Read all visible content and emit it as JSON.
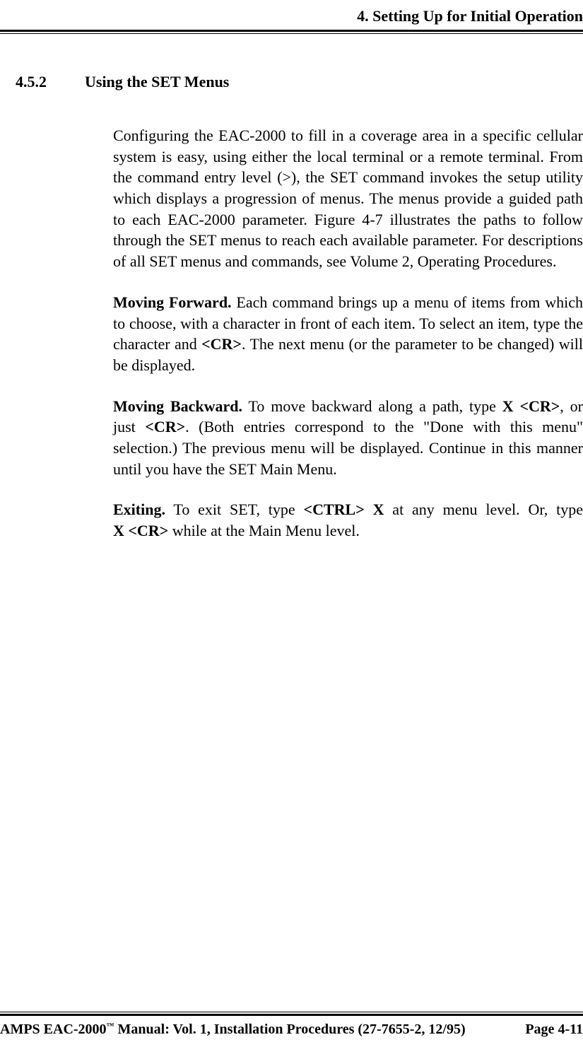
{
  "header": {
    "chapter": "4.  Setting Up for Initial Operation"
  },
  "section": {
    "number": "4.5.2",
    "title": "Using the SET Menus"
  },
  "paragraphs": {
    "intro": "Configuring the EAC-2000 to fill in a coverage area in a specific cellular system is easy, using either the local terminal or a remote terminal.  From the command entry level (>), the SET command invokes the setup utility which displays a progression of menus.  The menus provide a guided path to each EAC-2000 parameter.  Figure 4-7 illustrates the paths to follow through the SET menus to reach each available parameter.  For descriptions of all SET menus and commands, see Volume 2, Operating Procedures.",
    "forward_label": "Moving Forward.",
    "forward_1": "  Each command brings up a menu of items from which to choose, with a character in front of each item.  To select an item, type the character and ",
    "forward_cr": "<CR>",
    "forward_2": ".  The next menu (or the parameter to be changed) will be displayed.",
    "backward_label": "Moving Backward.",
    "backward_1": "  To move backward along a path, type ",
    "backward_xcr": "X <CR>",
    "backward_2": ", or just ",
    "backward_cr": "<CR>",
    "backward_3": ".  (Both entries correspond to the \"Done with this menu\" selection.)  The previous menu will be displayed.  Continue in this manner until you have the SET Main Menu.",
    "exiting_label": "Exiting.",
    "exiting_1": "  To exit SET, type ",
    "exiting_ctrl": "<CTRL> X",
    "exiting_2": " at any menu level.  Or, type ",
    "exiting_xcr": "X <CR>",
    "exiting_3": " while at the Main Menu level."
  },
  "footer": {
    "product": "AMPS EAC-2000",
    "tm": "™",
    "manual": " Manual:  Vol. 1, Installation Procedures (27-7655-2, 12/95)",
    "page": "Page 4-11"
  }
}
